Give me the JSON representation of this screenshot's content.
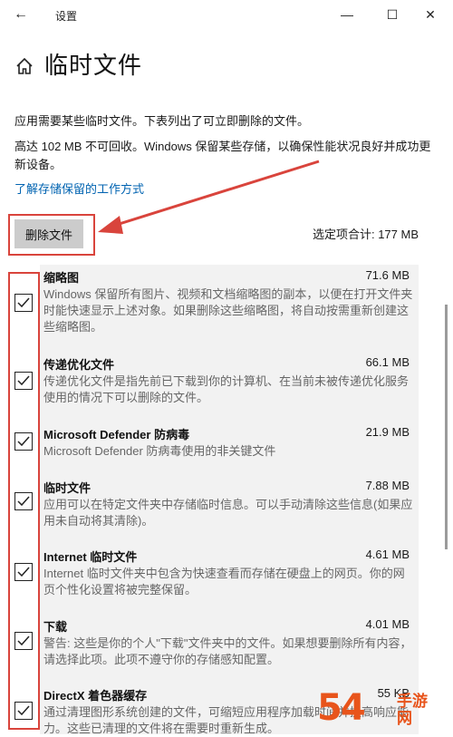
{
  "titlebar": {
    "back_label": "←",
    "title": "设置",
    "minimize": "—",
    "maximize": "☐",
    "close": "✕"
  },
  "page": {
    "title": "临时文件"
  },
  "description": {
    "line1": "应用需要某些临时文件。下表列出了可立即删除的文件。",
    "line2": "高达 102 MB 不可回收。Windows 保留某些存储，以确保性能状况良好并成功更新设备。"
  },
  "learn_link": "了解存储保留的工作方式",
  "delete_button": "删除文件",
  "selected_total": "选定项合计: 177 MB",
  "items": [
    {
      "name": "缩略图",
      "size": "71.6 MB",
      "desc": "Windows 保留所有图片、视频和文档缩略图的副本，以便在打开文件夹时能快速显示上述对象。如果删除这些缩略图，将自动按需重新创建这些缩略图。",
      "checked": true
    },
    {
      "name": "传递优化文件",
      "size": "66.1 MB",
      "desc": "传递优化文件是指先前已下载到你的计算机、在当前未被传递优化服务使用的情况下可以删除的文件。",
      "checked": true
    },
    {
      "name": "Microsoft Defender 防病毒",
      "size": "21.9 MB",
      "desc": "Microsoft Defender 防病毒使用的非关键文件",
      "checked": true
    },
    {
      "name": "临时文件",
      "size": "7.88 MB",
      "desc": "应用可以在特定文件夹中存储临时信息。可以手动清除这些信息(如果应用未自动将其清除)。",
      "checked": true
    },
    {
      "name": "Internet 临时文件",
      "size": "4.61 MB",
      "desc": "Internet 临时文件夹中包含为快速查看而存储在硬盘上的网页。你的网页个性化设置将被完整保留。",
      "checked": true
    },
    {
      "name": "下载",
      "size": "4.01 MB",
      "desc": "警告: 这些是你的个人\"下载\"文件夹中的文件。如果想要删除所有内容，请选择此项。此项不遵守你的存储感知配置。",
      "checked": true
    },
    {
      "name": "DirectX 着色器缓存",
      "size": "55 KB",
      "desc": "通过清理图形系统创建的文件，可缩短应用程序加载时间并提高响应能力。这些已清理的文件将在需要时重新生成。",
      "checked": true
    }
  ],
  "watermark": {
    "big": "54",
    "small1": "手游",
    "small2": "网"
  },
  "colors": {
    "accent_link": "#0063b1",
    "annotation_red": "#d9443c",
    "button_gray": "#cccccc",
    "list_bg": "#f2f2f2",
    "watermark_orange": "#e8541b"
  }
}
